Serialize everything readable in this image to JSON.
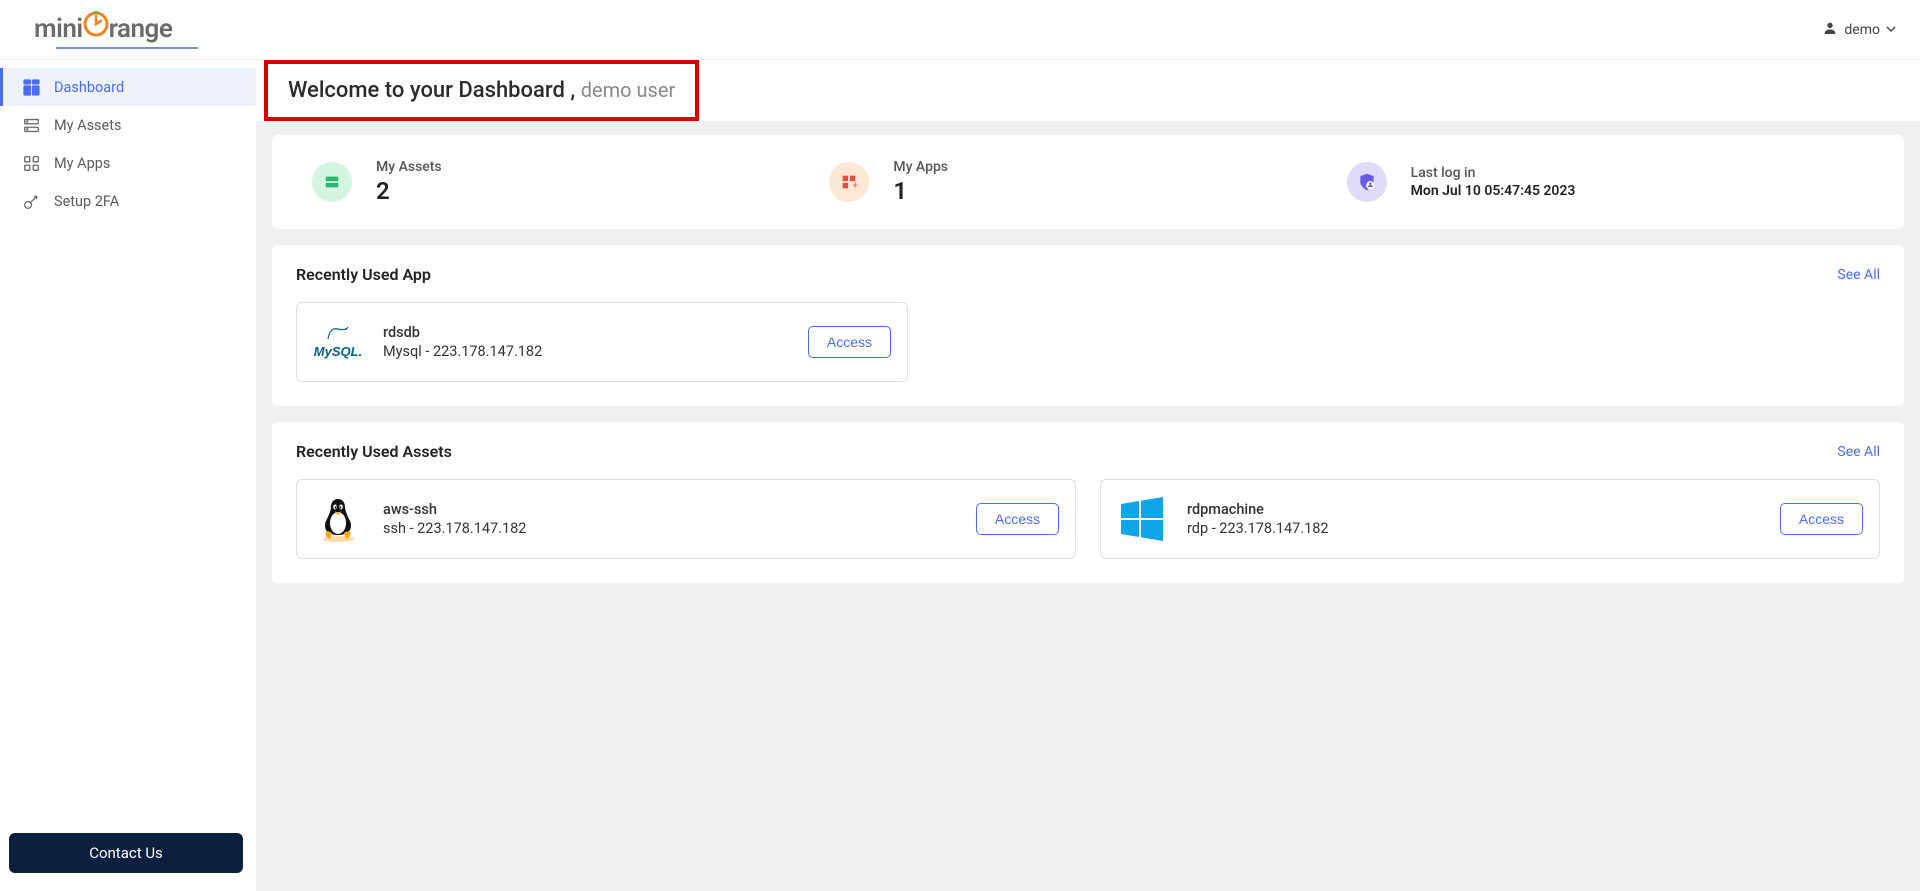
{
  "brand": {
    "prefix": "mini",
    "suffix": "range"
  },
  "user_menu": {
    "name": "demo"
  },
  "sidebar": {
    "items": [
      {
        "label": "Dashboard",
        "active": true
      },
      {
        "label": "My Assets",
        "active": false
      },
      {
        "label": "My Apps",
        "active": false
      },
      {
        "label": "Setup 2FA",
        "active": false
      }
    ],
    "contact_label": "Contact Us"
  },
  "welcome": {
    "title": "Welcome to your Dashboard , ",
    "user": "demo user"
  },
  "stats": {
    "assets": {
      "label": "My Assets",
      "value": "2"
    },
    "apps": {
      "label": "My Apps",
      "value": "1"
    },
    "lastlogin": {
      "label": "Last log in",
      "value": "Mon Jul 10 05:47:45 2023"
    }
  },
  "recent_app": {
    "title": "Recently Used App",
    "see_all": "See All",
    "item": {
      "name": "rdsdb",
      "detail": "Mysql - 223.178.147.182",
      "action": "Access"
    }
  },
  "recent_assets": {
    "title": "Recently Used Assets",
    "see_all": "See All",
    "items": [
      {
        "name": "aws-ssh",
        "detail": "ssh - 223.178.147.182",
        "action": "Access"
      },
      {
        "name": "rdpmachine",
        "detail": "rdp - 223.178.147.182",
        "action": "Access"
      }
    ]
  }
}
